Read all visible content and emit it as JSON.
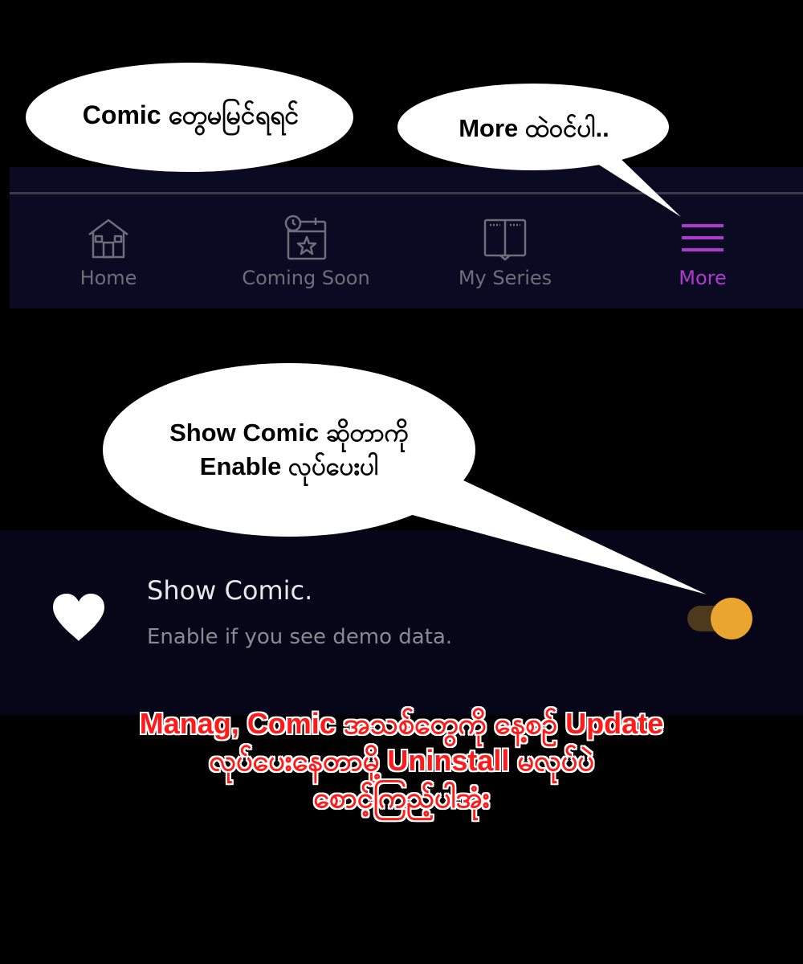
{
  "colors": {
    "background": "#000000",
    "navbar_bg": "#0a0a22",
    "nav_inactive": "#6e6e7a",
    "nav_active": "#b03ad0",
    "setting_bg": "#060618",
    "toggle_thumb": "#e9a530",
    "toggle_track": "#4d3a1c",
    "caption_text": "#ff1a1a",
    "caption_outline": "#ffffff",
    "bubble_fill": "#ffffff"
  },
  "bubbles": {
    "top_left": "Comic တွေမမြင်ရရင်",
    "top_right": "More ထဲဝင်ပါ..",
    "middle_line1": "Show Comic ဆိုတာကို",
    "middle_line2": "Enable လုပ်ပေးပါ"
  },
  "nav": {
    "items": [
      {
        "label": "Home",
        "icon": "home-icon",
        "active": false
      },
      {
        "label": "Coming Soon",
        "icon": "calendar-star-icon",
        "active": false
      },
      {
        "label": "My Series",
        "icon": "book-icon",
        "active": false
      },
      {
        "label": "More",
        "icon": "menu-icon",
        "active": true
      }
    ]
  },
  "setting": {
    "icon": "heart-icon",
    "title": "Show Comic.",
    "subtitle": "Enable if you see demo data.",
    "toggle_on": true
  },
  "caption": {
    "line1": "Manag, Comic အသစ်တွေကို နေ့စဉ် Update",
    "line2": "လုပ်ပေးနေတာမို့ Uninstall မလုပ်ပဲ",
    "line3": "စောင့်ကြည့်ပါအုံး"
  }
}
